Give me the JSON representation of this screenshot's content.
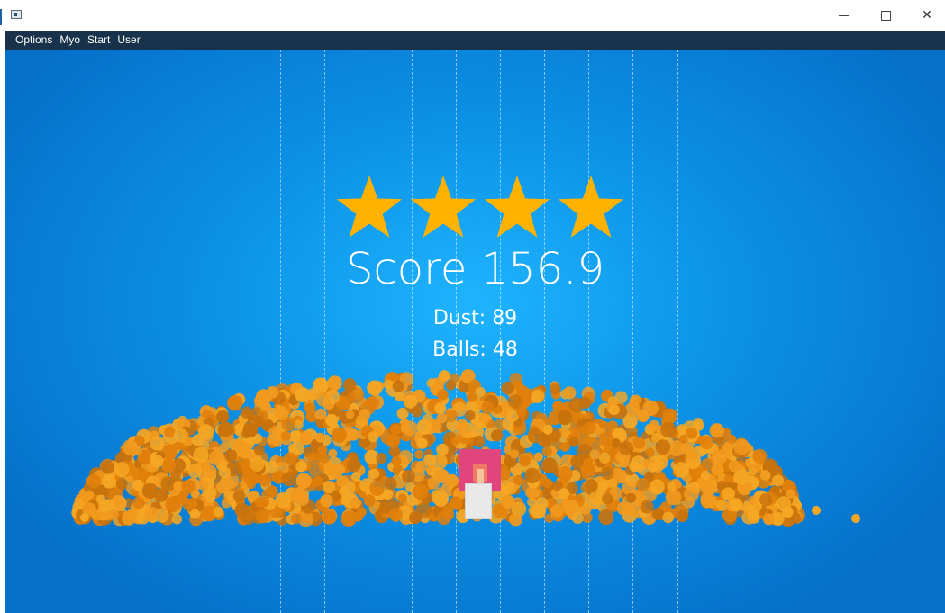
{
  "window": {
    "app_icon": "window-app-icon",
    "controls": {
      "minimize": "minimize-icon",
      "maximize": "maximize-icon",
      "close_glyph": "✕"
    }
  },
  "menu": {
    "items": [
      "Options",
      "Myo",
      "Start",
      "User"
    ]
  },
  "game": {
    "stars_earned": 4,
    "star_color": "#FFB300",
    "score_text": "Score 156.9",
    "dust_text": "Dust: 89",
    "balls_text": "Balls: 48",
    "background_color": "#0C93E6",
    "ball_colors": [
      "#E07F0A",
      "#F29A1E",
      "#C8720C",
      "#F5A623"
    ],
    "player_colors": {
      "block": "#E0457E",
      "flame": "#F07A66",
      "body": "#E9E9E9"
    }
  }
}
